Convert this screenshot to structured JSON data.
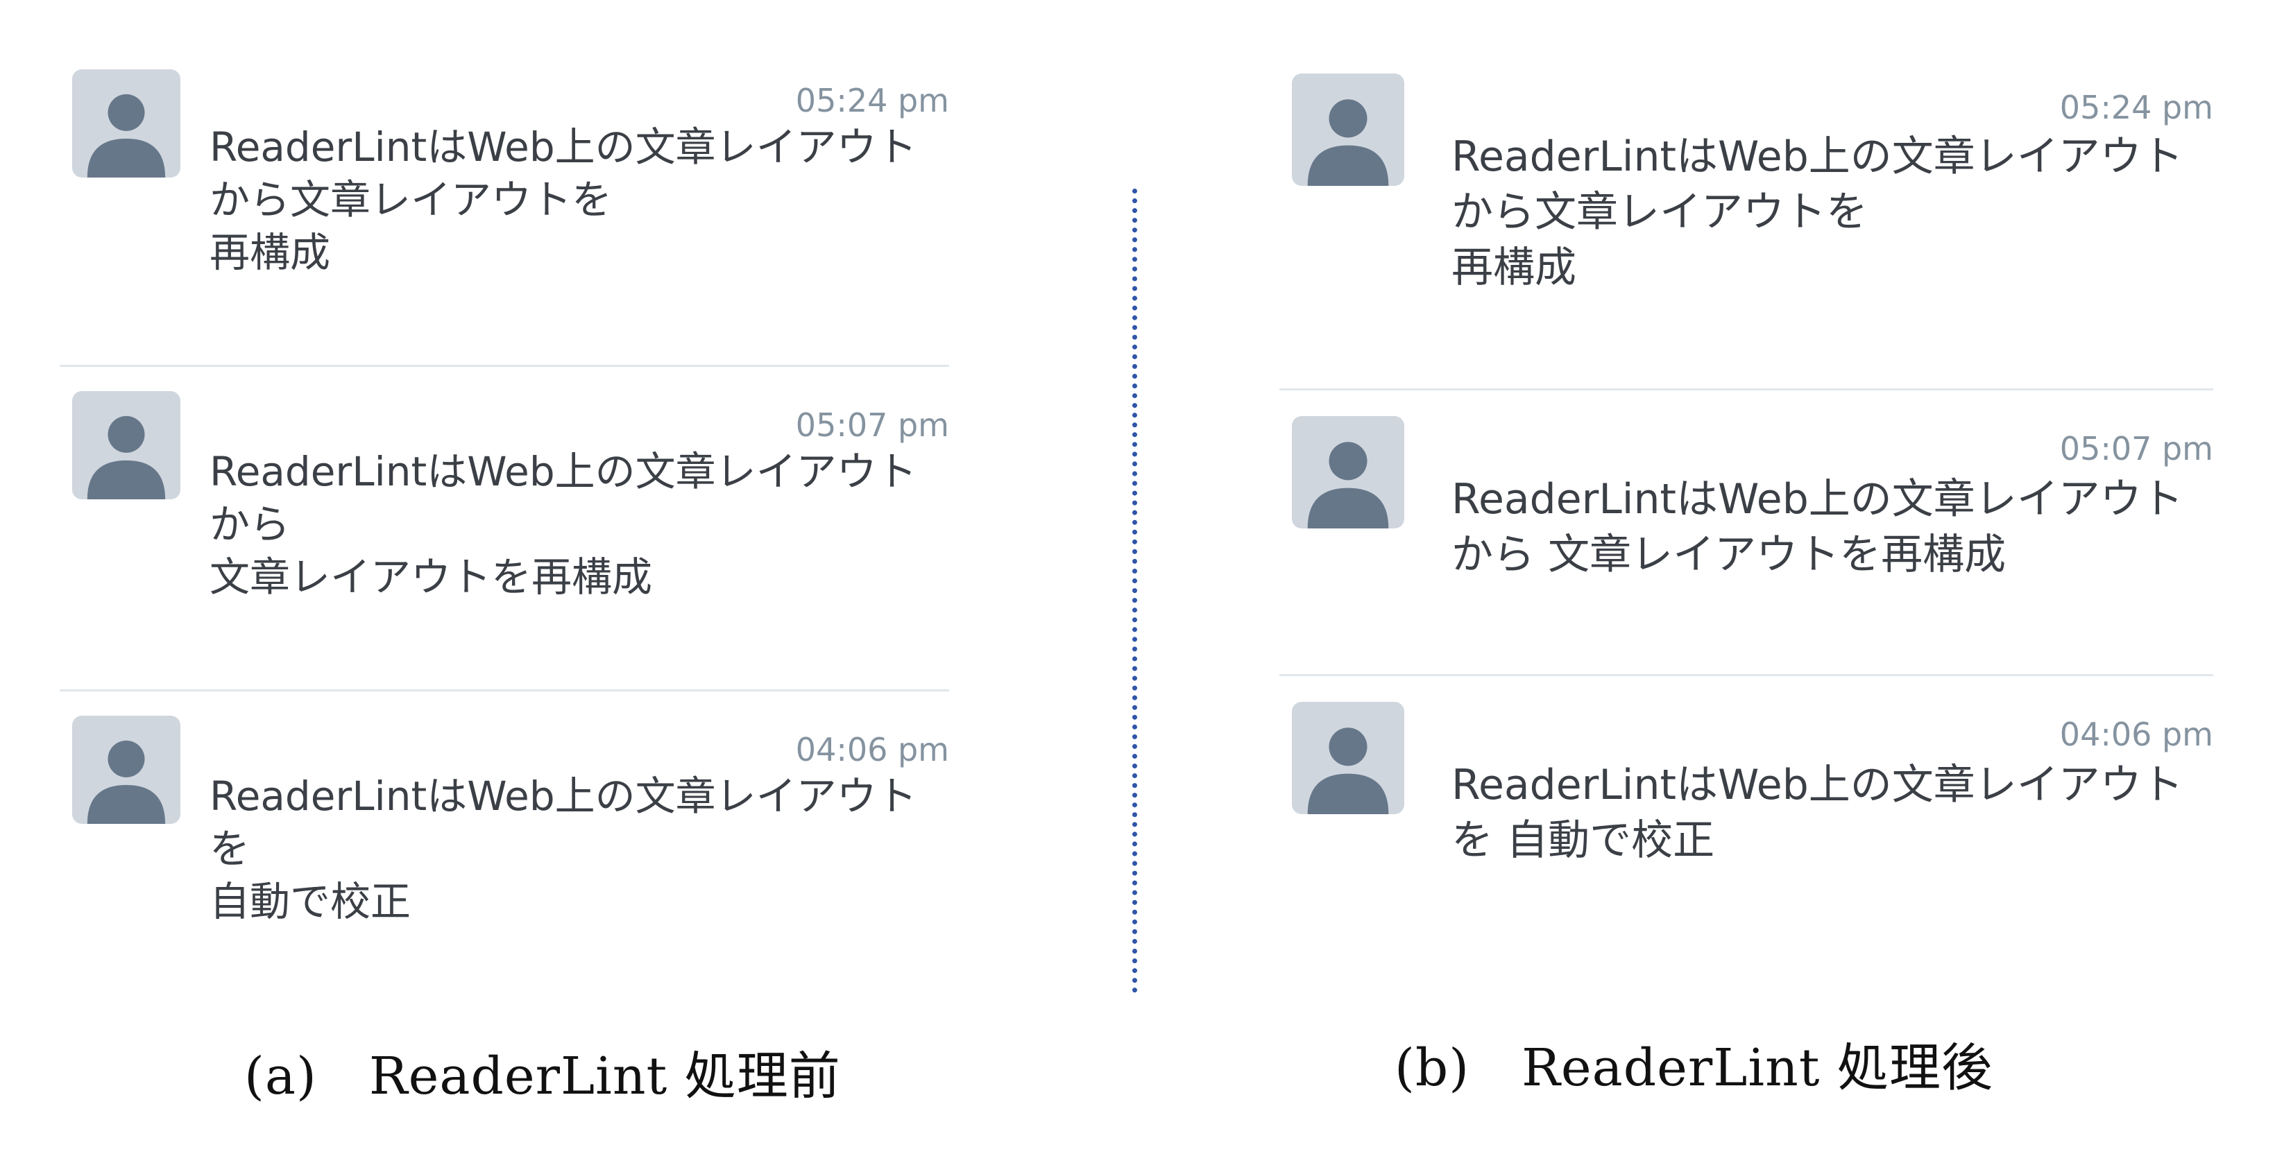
{
  "panels": [
    {
      "caption": "(a)　ReaderLint 処理前",
      "messages": [
        {
          "time": "05:24 pm",
          "lines": [
            "ReaderLintはWeb上の文章レイアウト",
            "から文章レイアウトを",
            "再構成"
          ]
        },
        {
          "time": "05:07 pm",
          "lines": [
            "ReaderLintはWeb上の文章レイアウト",
            "から",
            "文章レイアウトを再構成"
          ]
        },
        {
          "time": "04:06 pm",
          "lines": [
            "ReaderLintはWeb上の文章レイアウト",
            "を",
            "自動で校正"
          ]
        }
      ]
    },
    {
      "caption": "(b)　ReaderLint 処理後",
      "messages": [
        {
          "time": "05:24 pm",
          "lines": [
            "ReaderLintはWeb上の文章レイアウト",
            "から文章レイアウトを",
            "再構成"
          ]
        },
        {
          "time": "05:07 pm",
          "lines": [
            "ReaderLintはWeb上の文章レイアウト",
            "から 文章レイアウトを再構成"
          ]
        },
        {
          "time": "04:06 pm",
          "lines": [
            "ReaderLintはWeb上の文章レイアウト",
            "を 自動で校正"
          ]
        }
      ]
    }
  ],
  "icons": {
    "avatar": "default-user-avatar-icon"
  },
  "colors": {
    "avatar_bg": "#cfd6de",
    "avatar_fg": "#67778a",
    "timestamp": "#8593a0",
    "message_text": "#3b3f46",
    "divider": "#e1e7ec",
    "separator": "#2f55a8"
  }
}
